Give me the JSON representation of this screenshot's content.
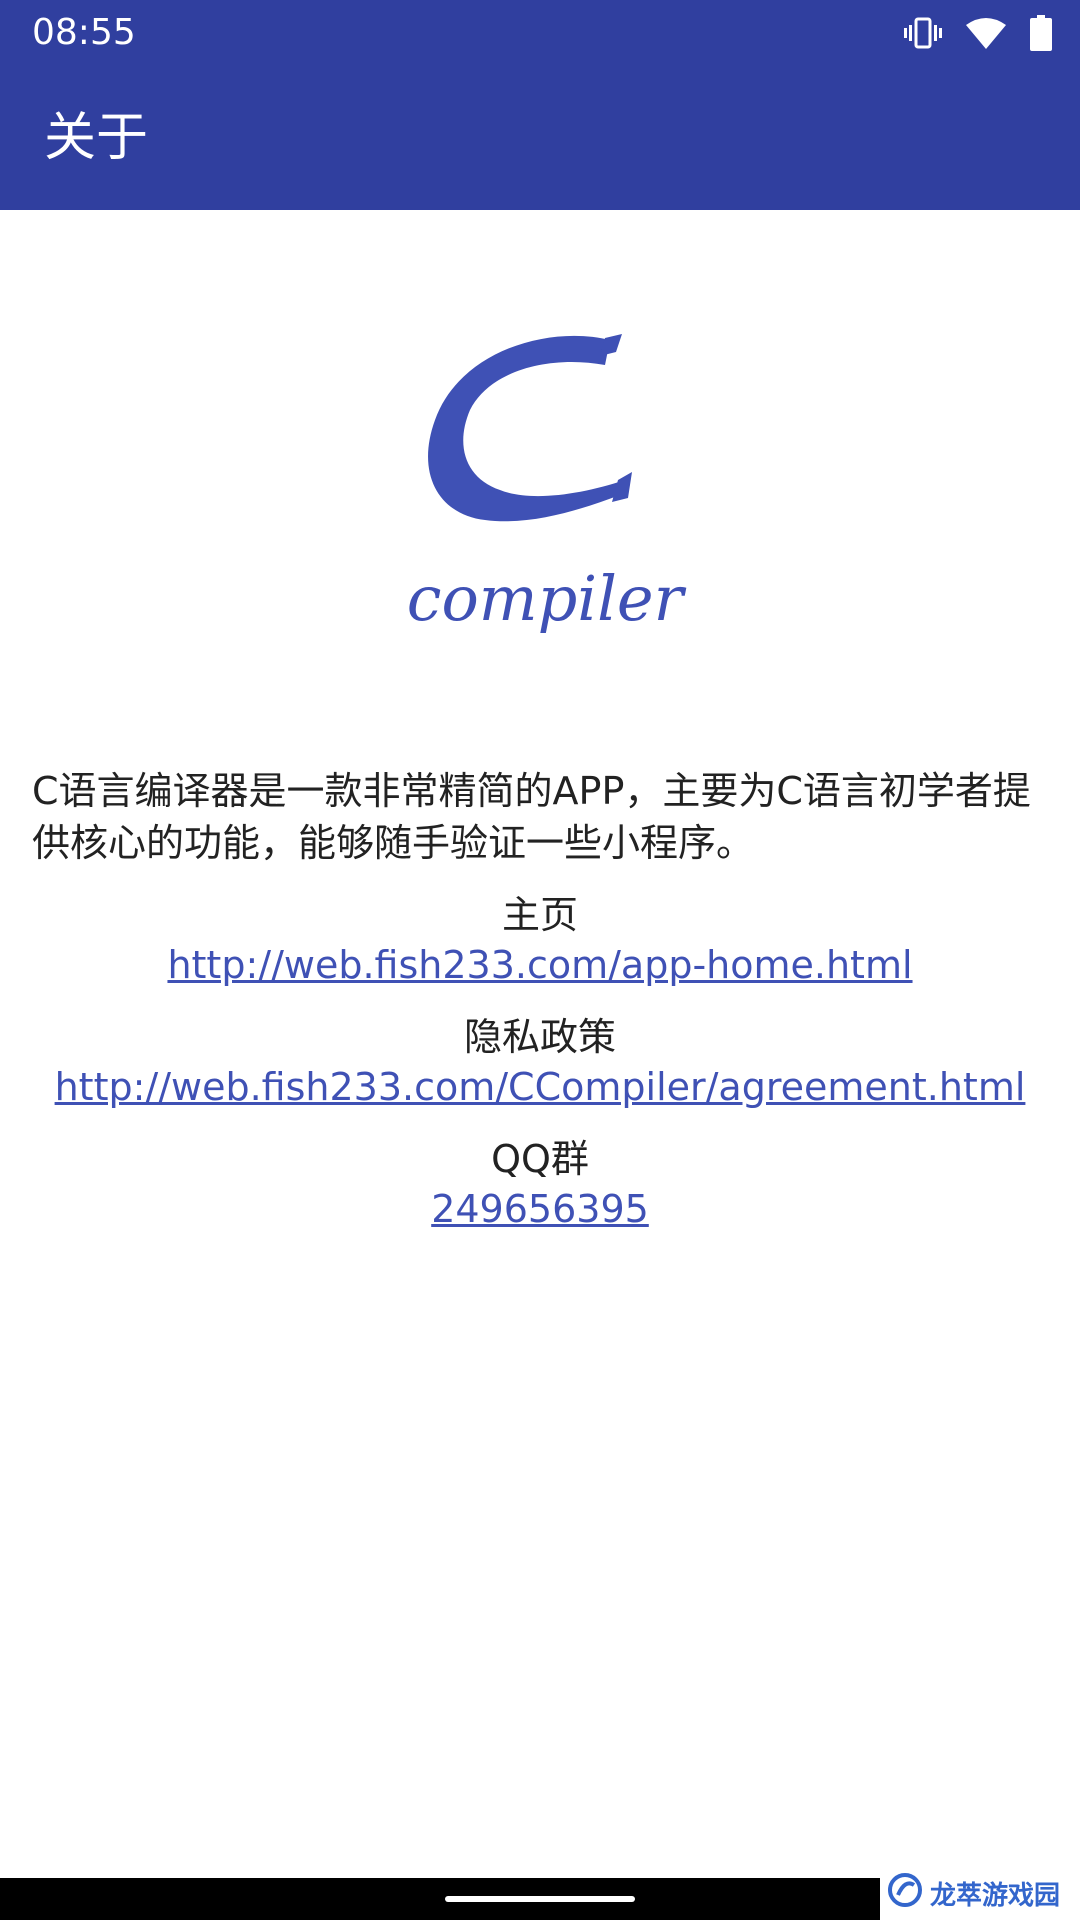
{
  "status": {
    "time": "08:55",
    "icons": [
      "vibrate-icon",
      "wifi-icon",
      "battery-icon"
    ]
  },
  "appbar": {
    "title": "关于",
    "color": "#303F9F"
  },
  "logo": {
    "letter": "C",
    "word": "compiler",
    "color": "#3F51B5"
  },
  "content": {
    "description": "C语言编译器是一款非常精简的APP，主要为C语言初学者提供核心的功能，能够随手验证一些小程序。",
    "sections": [
      {
        "label": "主页",
        "link": "http://web.fish233.com/app-home.html"
      },
      {
        "label": "隐私政策",
        "link": "http://web.fish233.com/CCompiler/agreement.html"
      },
      {
        "label": "QQ群",
        "link": "249656395"
      }
    ],
    "link_color": "#3F51B5"
  },
  "watermark": {
    "text": "龙萃游戏园"
  }
}
